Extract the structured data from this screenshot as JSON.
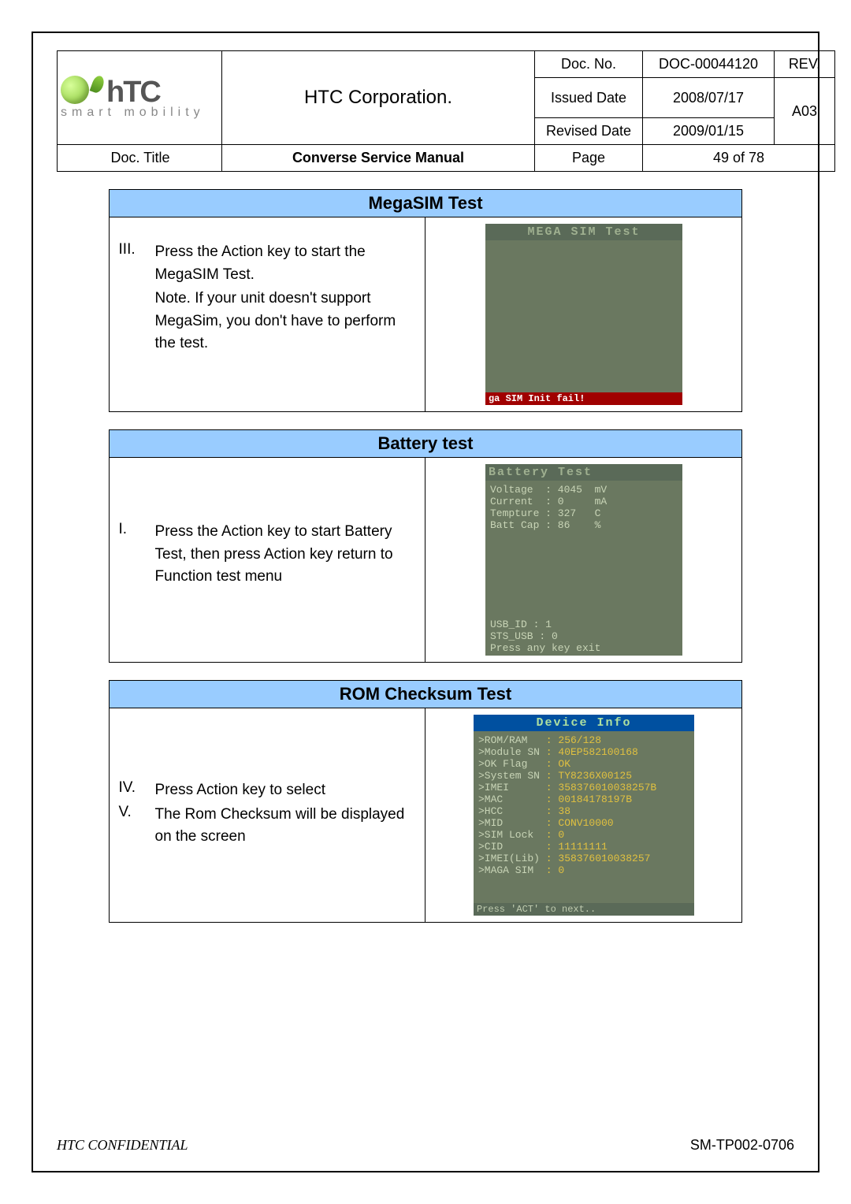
{
  "header": {
    "company": "HTC Corporation.",
    "logo_text": "hTC",
    "logo_tag": "smart mobility",
    "doc_no_label": "Doc. No.",
    "doc_no": "DOC-00044120",
    "rev_label": "REV.",
    "rev": "A03",
    "issued_label": "Issued Date",
    "issued": "2008/07/17",
    "revised_label": "Revised Date",
    "revised": "2009/01/15",
    "doc_title_label": "Doc. Title",
    "doc_title": "Converse Service Manual",
    "page_label": "Page",
    "page_value": "49  of  78"
  },
  "sections": {
    "megasim": {
      "title": "MegaSIM Test",
      "items": [
        {
          "num": "III.",
          "text": "Press the Action key to start the MegaSIM Test."
        },
        {
          "num": "",
          "text": "Note. If your unit doesn't support MegaSim, you don't have to perform the test."
        }
      ],
      "screen": {
        "title": "MEGA SIM Test",
        "footer": "ga SIM Init fail!"
      }
    },
    "battery": {
      "title": "Battery test",
      "items": [
        {
          "num": "I.",
          "text": "Press the Action key to start Battery Test, then press Action key return to Function test menu"
        }
      ],
      "screen": {
        "title": "Battery   Test",
        "rows": [
          {
            "k": "Voltage ",
            "v": ": 4045  mV"
          },
          {
            "k": "Current ",
            "v": ": 0     mA"
          },
          {
            "k": "Tempture",
            "v": ": 327   C"
          },
          {
            "k": "Batt Cap",
            "v": ": 86    %"
          }
        ],
        "footer_rows": [
          "USB_ID  : 1",
          "STS_USB : 0",
          "Press any key exit"
        ]
      }
    },
    "rom": {
      "title": "ROM Checksum Test",
      "items": [
        {
          "num": "IV.",
          "text": "Press Action key to select"
        },
        {
          "num": "V.",
          "text": "The Rom Checksum will be displayed on the screen"
        }
      ],
      "screen": {
        "title": "Device Info",
        "rows": [
          {
            "k": ">ROM/RAM   ",
            "v": ": 256/128"
          },
          {
            "k": ">Module SN ",
            "v": ": 40EP582100168"
          },
          {
            "k": ">OK Flag   ",
            "v": ": OK"
          },
          {
            "k": ">System SN ",
            "v": ": TY8236X00125"
          },
          {
            "k": ">IMEI      ",
            "v": ": 358376010038257B"
          },
          {
            "k": ">MAC       ",
            "v": ": 00184178197B"
          },
          {
            "k": ">HCC       ",
            "v": ": 38"
          },
          {
            "k": ">MID       ",
            "v": ": CONV10000"
          },
          {
            "k": ">SIM Lock  ",
            "v": ": 0"
          },
          {
            "k": ">CID       ",
            "v": ": 11111111"
          },
          {
            "k": ">IMEI(Lib) ",
            "v": ": 358376010038257"
          },
          {
            "k": ">MAGA SIM  ",
            "v": ": 0"
          }
        ],
        "footer": "Press 'ACT' to next.."
      }
    }
  },
  "footer": {
    "confidential": "HTC CONFIDENTIAL",
    "form_no": "SM-TP002-0706"
  }
}
